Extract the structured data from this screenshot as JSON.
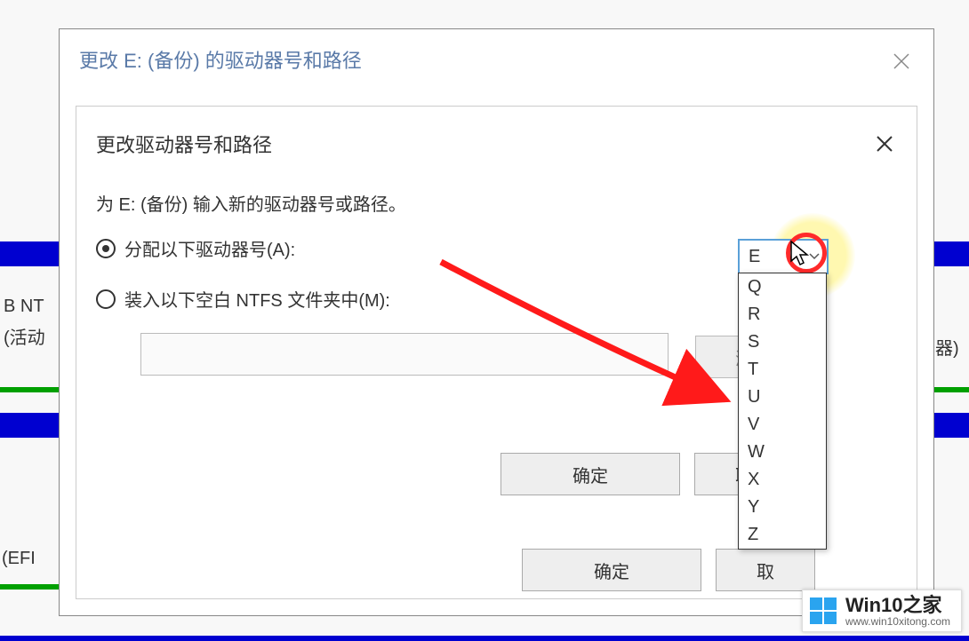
{
  "bg": {
    "partial1": "B NT",
    "partial2": "(活动",
    "partial3": "(EFI ",
    "partial4": "器)"
  },
  "outerDialog": {
    "title": "更改 E: (备份) 的驱动器号和路径",
    "okLabel": "确定",
    "cancelLabel": "取"
  },
  "innerDialog": {
    "title": "更改驱动器号和路径",
    "instruction": "为 E: (备份) 输入新的驱动器号或路径。",
    "radioAssign": "分配以下驱动器号(A):",
    "radioMount": "装入以下空白 NTFS 文件夹中(M):",
    "browseLabel": "浏",
    "okLabel": "确定",
    "cancelLabel": "取",
    "selectedDrive": "E",
    "driveOptions": [
      "Q",
      "R",
      "S",
      "T",
      "U",
      "V",
      "W",
      "X",
      "Y",
      "Z"
    ]
  },
  "watermark": {
    "title": "Win10之家",
    "url": "www.win10xitong.com"
  }
}
